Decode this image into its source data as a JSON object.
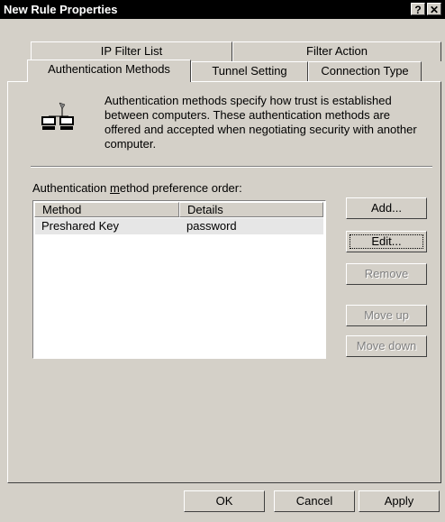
{
  "window": {
    "title": "New Rule Properties",
    "help": "?",
    "close": "✕"
  },
  "tabs": {
    "row1": [
      "IP Filter List",
      "Filter Action"
    ],
    "row2": [
      "Authentication Methods",
      "Tunnel Setting",
      "Connection Type"
    ],
    "active": "Authentication Methods"
  },
  "description": "Authentication methods specify how trust is established between computers. These authentication methods are offered and accepted when negotiating security with another computer.",
  "list": {
    "label_pre": "Authentication ",
    "label_u": "m",
    "label_post": "ethod preference order:",
    "columns": [
      "Method",
      "Details"
    ],
    "rows": [
      {
        "method": "Preshared Key",
        "details": "password"
      }
    ]
  },
  "side_buttons": {
    "add": "Add...",
    "edit": "Edit...",
    "remove": "Remove",
    "move_up": "Move up",
    "move_down": "Move down"
  },
  "footer": {
    "ok": "OK",
    "cancel": "Cancel",
    "apply": "Apply"
  },
  "icons": {
    "computers": "network-computers-icon"
  }
}
